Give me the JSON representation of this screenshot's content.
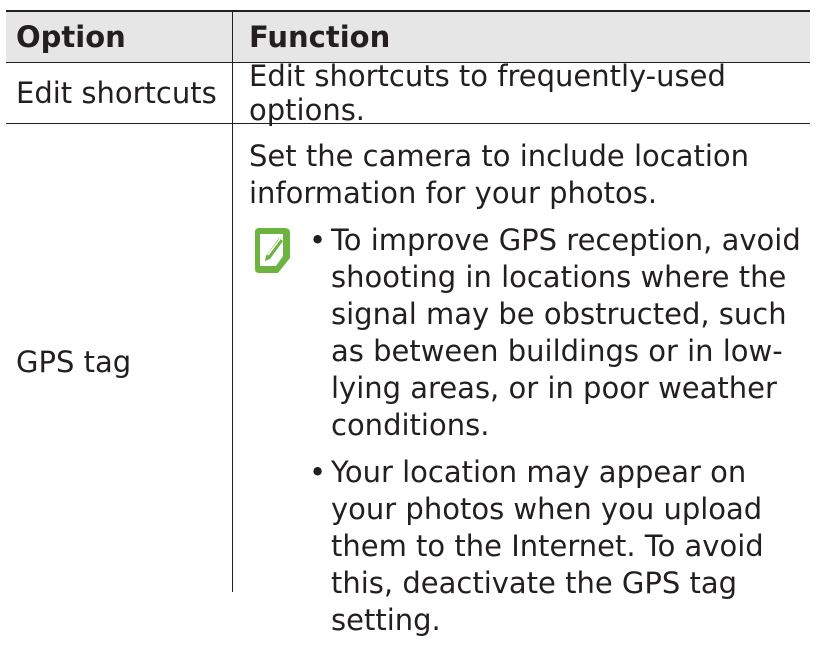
{
  "table": {
    "headers": {
      "option": "Option",
      "function": "Function"
    },
    "rows": [
      {
        "option": "Edit shortcuts",
        "function": "Edit shortcuts to frequently-used options."
      },
      {
        "option": "GPS tag",
        "function": "Set the camera to include location information for your photos.",
        "note_icon": "note-pencil-icon",
        "note_color": "#6cb33f",
        "notes": [
          "To improve GPS reception, avoid shooting in locations where the signal may be obstructed, such as between buildings or in low-lying areas, or in poor weather conditions.",
          "Your location may appear on your photos when you upload them to the Internet. To avoid this, deactivate the GPS tag setting."
        ]
      }
    ]
  },
  "bullet_glyph": "•"
}
